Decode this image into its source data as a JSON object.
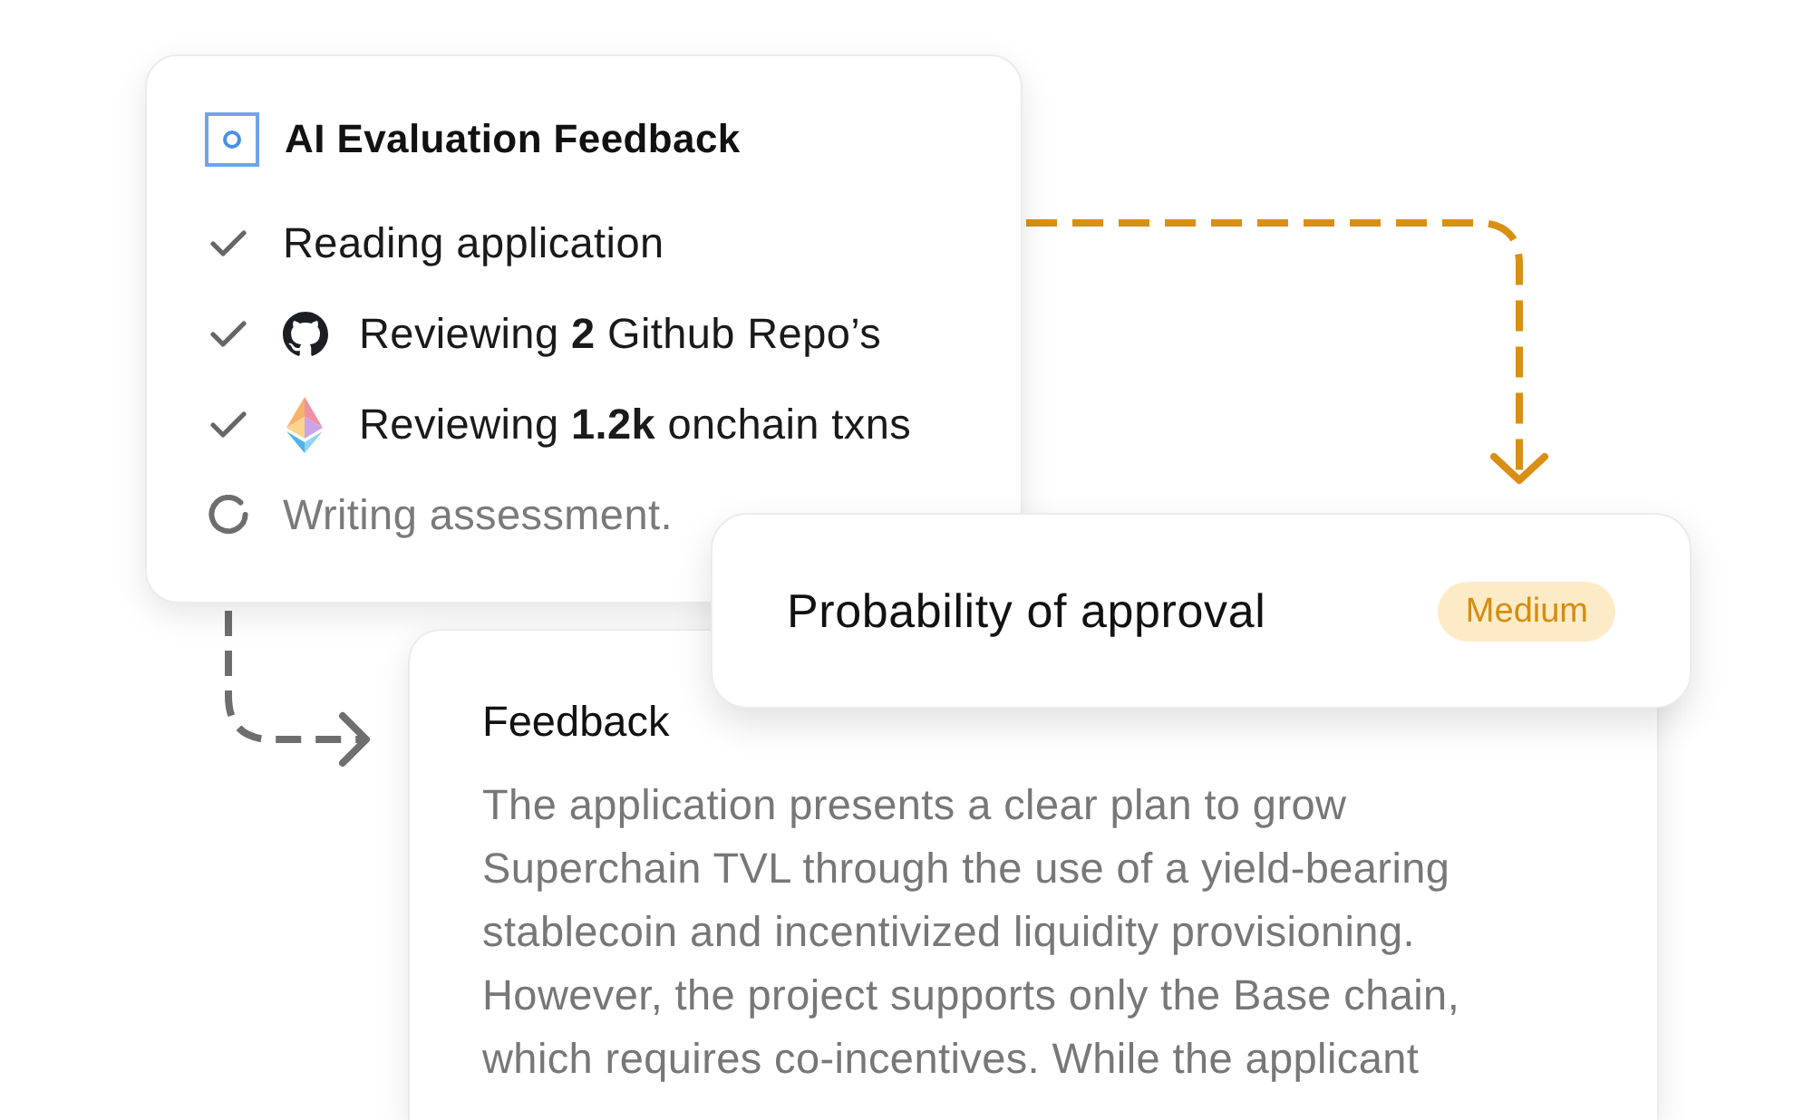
{
  "evaluation_card": {
    "title": "AI Evaluation Feedback",
    "steps": [
      {
        "kind": "plain",
        "text": "Reading application",
        "done": true
      },
      {
        "kind": "repo",
        "text": "Reviewing **2** Github Repo’s",
        "done": true
      },
      {
        "kind": "onchain",
        "text": "Reviewing **1.2k** onchain txns",
        "done": true
      },
      {
        "kind": "plain",
        "text": "Writing assessment.",
        "done": false
      }
    ]
  },
  "approval_card": {
    "label": "Probability of approval",
    "badge": "Medium"
  },
  "feedback_card": {
    "title": "Feedback",
    "body": "The application presents a clear plan to grow Superchain TVL through the use of a yield-bearing stablecoin and incentivized liquidity provisioning. However, the project supports only the Base chain, which requires co-incentives. While the applicant"
  }
}
